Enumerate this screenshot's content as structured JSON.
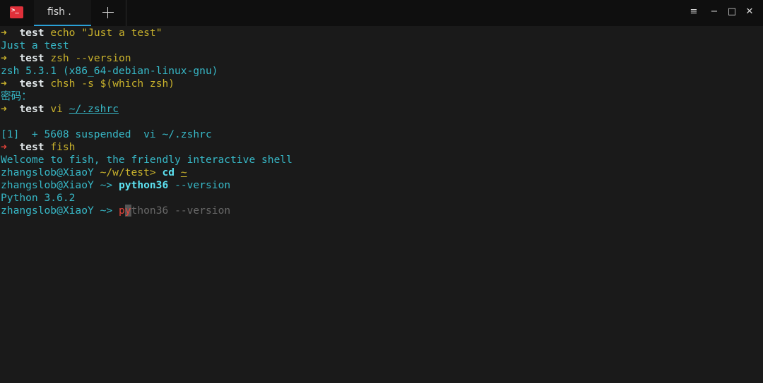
{
  "window": {
    "tab_label": "fish .",
    "app_icon": "terminal-icon",
    "app_icon_glyph": ">_",
    "new_tab_icon": "plus-icon",
    "controls": {
      "menu": "≡",
      "minimize": "−",
      "maximize": "□",
      "close": "✕"
    }
  },
  "colors": {
    "background": "#1a1a1a",
    "titlebar": "#0f0f0f",
    "accent": "#2aa1d8",
    "cyan": "#37b8c7",
    "yellow": "#c9b22c",
    "red": "#e5443a"
  },
  "terminal": {
    "arrow": "➜",
    "l1": {
      "dir": "test",
      "cmd": "echo",
      "arg": "\"Just a test\""
    },
    "l2": "Just a test",
    "l3": {
      "dir": "test",
      "cmd": "zsh",
      "arg": "--version"
    },
    "l4": "zsh 5.3.1 (x86_64-debian-linux-gnu)",
    "l5": {
      "dir": "test",
      "cmd": "chsh",
      "arg": "-s $(which zsh)"
    },
    "l6": "密码：",
    "l7": {
      "dir": "test",
      "cmd": "vi",
      "arg": "~/.zshrc"
    },
    "l9": "[1]  + 5608 suspended  vi ~/.zshrc",
    "l10": {
      "dir": "test",
      "cmd": "fish"
    },
    "l11": "Welcome to fish, the friendly interactive shell",
    "l12": {
      "userhost": "zhangslob@XiaoY",
      "path": "~/w/test>",
      "cmd": "cd",
      "arg": "~"
    },
    "l13": {
      "userhost": "zhangslob@XiaoY",
      "prompt": "~>",
      "cmd": "python36",
      "arg": "--version"
    },
    "l14": "Python 3.6.2",
    "l15": {
      "userhost": "zhangslob@XiaoY",
      "prompt": "~>",
      "typed": "p",
      "cursor_char": "y",
      "suggestion": "thon36 --version"
    }
  }
}
